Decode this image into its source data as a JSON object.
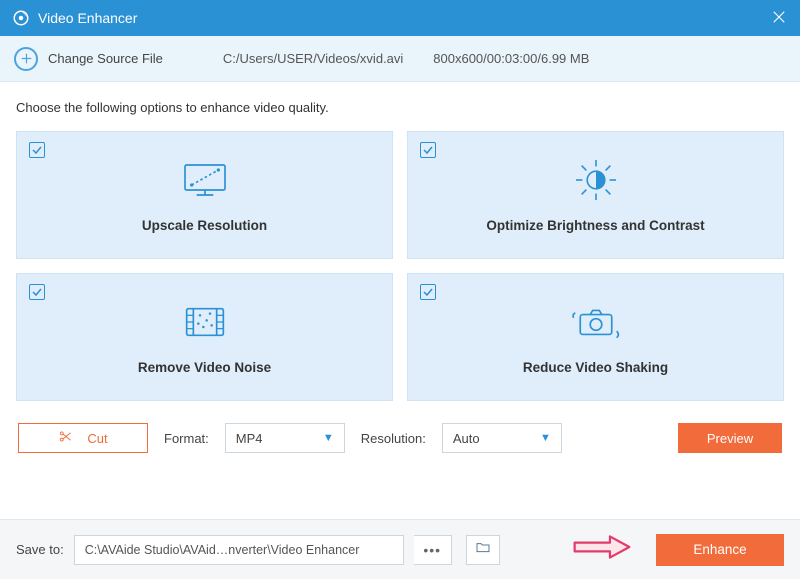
{
  "title": "Video Enhancer",
  "topbar": {
    "change_label": "Change Source File",
    "path": "C:/Users/USER/Videos/xvid.avi",
    "meta": "800x600/00:03:00/6.99 MB"
  },
  "prompt": "Choose the following options to enhance video quality.",
  "cards": {
    "upscale": "Upscale Resolution",
    "brightness": "Optimize Brightness and Contrast",
    "noise": "Remove Video Noise",
    "shaking": "Reduce Video Shaking"
  },
  "controls": {
    "cut": "Cut",
    "format_label": "Format:",
    "format_value": "MP4",
    "resolution_label": "Resolution:",
    "resolution_value": "Auto",
    "preview": "Preview"
  },
  "footer": {
    "save_label": "Save to:",
    "save_path": "C:\\AVAide Studio\\AVAid…nverter\\Video Enhancer",
    "enhance": "Enhance"
  }
}
